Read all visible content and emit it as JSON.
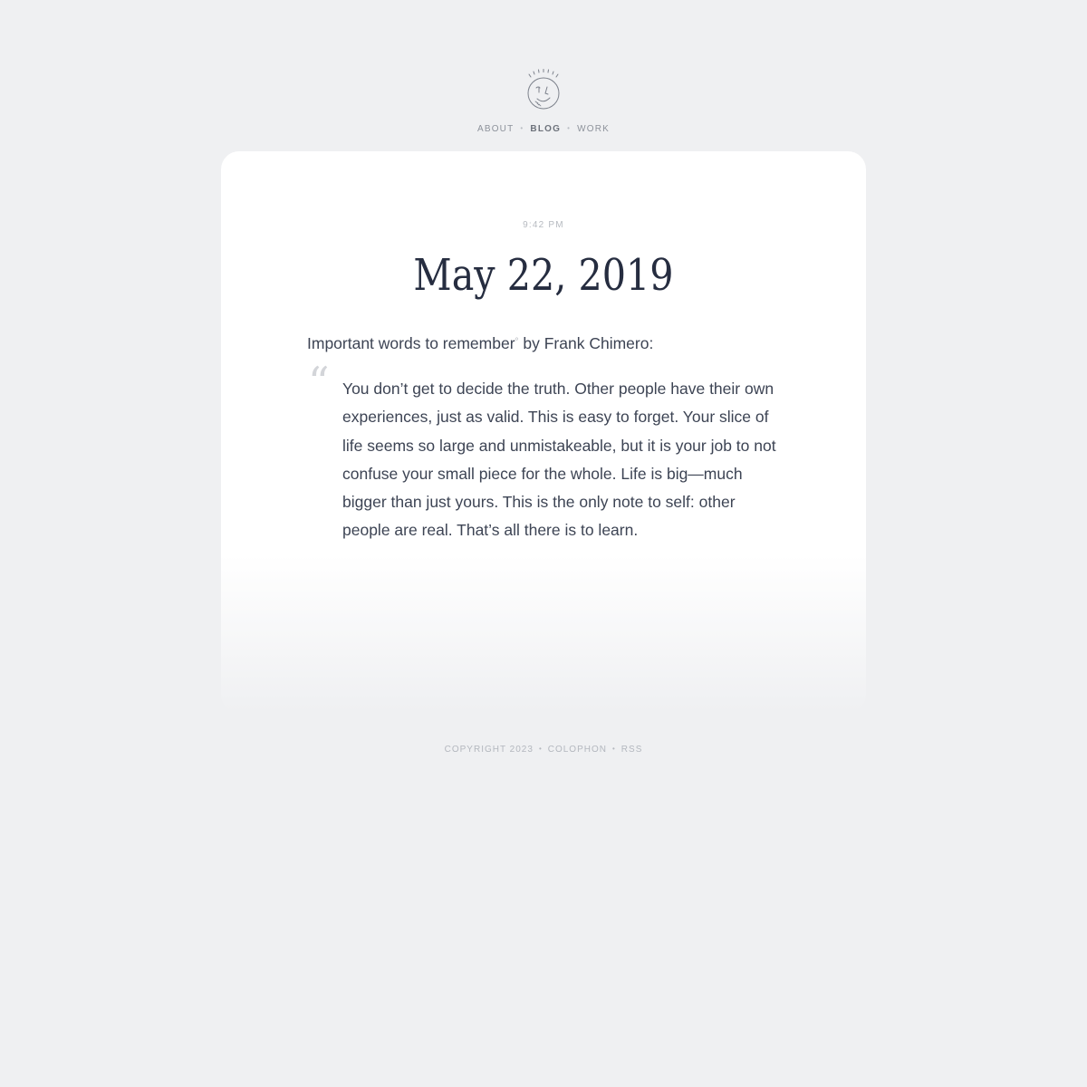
{
  "nav": {
    "items": [
      {
        "label": "ABOUT",
        "active": false
      },
      {
        "label": "BLOG",
        "active": true
      },
      {
        "label": "WORK",
        "active": false
      }
    ],
    "separator": "•"
  },
  "post": {
    "time": "9:42 PM",
    "title": "May 22, 2019",
    "intro_text": "Important words to remember",
    "intro_link_marker": "°",
    "intro_suffix": " by Frank Chimero:",
    "quote_mark": "“",
    "quote": "You don’t get to decide the truth. Other people have their own experiences, just as valid. This is easy to forget. Your slice of life seems so large and unmistakeable, but it is your job to not confuse your small piece for the whole. Life is big—much bigger than just yours. This is the only note to self: other people are real. That’s all there is to learn."
  },
  "footer": {
    "copyright": "COPYRIGHT 2023",
    "colophon": "COLOPHON",
    "rss": "RSS",
    "separator": "•"
  },
  "colors": {
    "background": "#eff0f2",
    "card": "#ffffff",
    "heading": "#262d40",
    "body_text": "#3d4454",
    "muted": "#b3b7be"
  },
  "icons": {
    "logo": "smiling-face-sun-logo-icon"
  }
}
